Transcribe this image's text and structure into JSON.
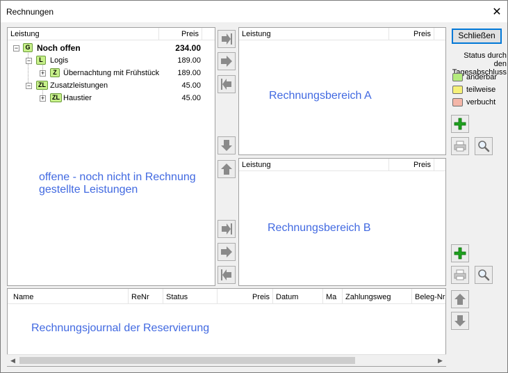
{
  "window": {
    "title": "Rechnungen",
    "close_glyph": "✕"
  },
  "tree_panel": {
    "columns": [
      "Leistung",
      "Preis"
    ],
    "rows": [
      {
        "badge": "G",
        "label": "Noch offen",
        "price": "234.00",
        "bold": true
      },
      {
        "badge": "L",
        "label": "Logis",
        "price": "189.00"
      },
      {
        "badge": "Z",
        "label": "Übernachtung mit Frühstück",
        "price": "189.00"
      },
      {
        "badge": "ZL",
        "label": "Zusatzleistungen",
        "price": "45.00"
      },
      {
        "badge": "ZL",
        "label": "Haustier",
        "price": "45.00"
      }
    ],
    "overlay_text": "offene - noch nicht in Rechnung gestellte Leistungen"
  },
  "invoice_a": {
    "columns": [
      "Leistung",
      "Preis"
    ],
    "overlay_text": "Rechnungsbereich A"
  },
  "invoice_b": {
    "columns": [
      "Leistung",
      "Preis"
    ],
    "overlay_text": "Rechnungsbereich B"
  },
  "journal": {
    "columns": [
      "Name",
      "ReNr",
      "Status",
      "Preis",
      "Datum",
      "Ma",
      "Zahlungsweg",
      "Beleg-Nr"
    ],
    "overlay_text": "Rechnungsjournal der Reservierung",
    "scroll_left": "◀",
    "scroll_right": "▶"
  },
  "sidebar": {
    "close_label": "Schließen",
    "status_title": "Status durch den Tagesabschluss",
    "legend": [
      {
        "label": "änderbar",
        "color": "#b5ec7e"
      },
      {
        "label": "teilweise",
        "color": "#f5f078"
      },
      {
        "label": "verbucht",
        "color": "#f4b6a8"
      }
    ]
  },
  "icons": {
    "add": "plus-icon",
    "print": "printer-icon",
    "search": "magnifier-icon",
    "move_all_right": "arrow-to-right-end-icon",
    "move_right": "arrow-right-icon",
    "move_all_left": "arrow-to-left-end-icon",
    "move_down": "arrow-down-icon",
    "move_up": "arrow-up-icon"
  }
}
